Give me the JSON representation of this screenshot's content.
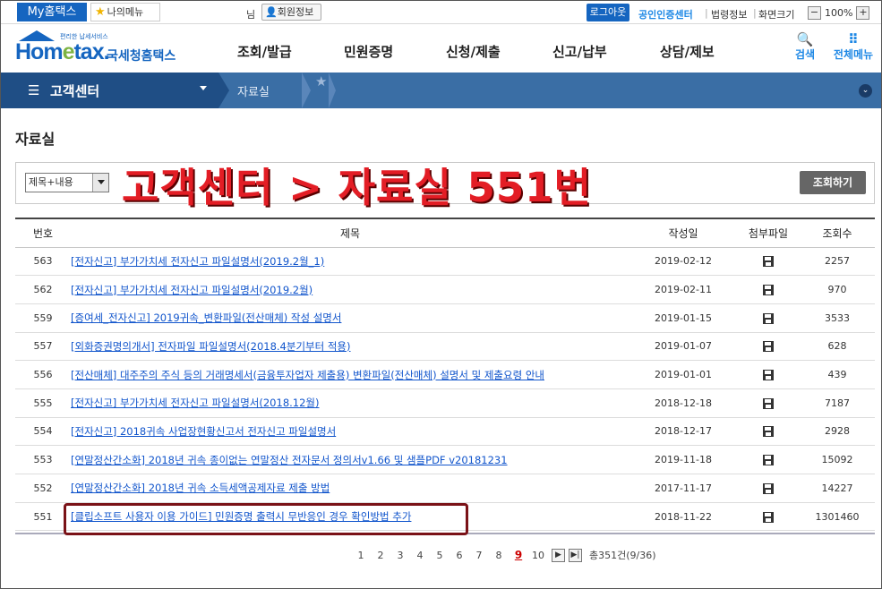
{
  "topbar": {
    "my_hometax": "My홈택스",
    "my_menu": "나의메뉴",
    "user_suffix": "님",
    "member_info": "회원정보",
    "logout": "로그아웃",
    "cert_center": "공인인증센터",
    "law_info": "법령정보",
    "screen_size": "화면크기",
    "zoom_minus": "−",
    "zoom_value": "100%",
    "zoom_plus": "+"
  },
  "header": {
    "logo_small": "편리한 납세서비스",
    "logo_main_a": "Hom",
    "logo_main_e": "e",
    "logo_main_b": "tax.",
    "logo_sub": "국세청홈택스",
    "nav": [
      "조회/발급",
      "민원증명",
      "신청/제출",
      "신고/납부",
      "상담/제보"
    ],
    "search_label": "검색",
    "allmenu_label": "전체메뉴"
  },
  "location": {
    "section": "고객센터",
    "current": "자료실"
  },
  "page": {
    "title": "자료실",
    "select_value": "제목+내용",
    "overlay_caption": "고객센터 > 자료실 551번",
    "search_button": "조회하기"
  },
  "table": {
    "headers": {
      "no": "번호",
      "title": "제목",
      "date": "작성일",
      "file": "첨부파일",
      "views": "조회수"
    },
    "rows": [
      {
        "no": "563",
        "title": "[전자신고] 부가가치세 전자신고 파일설명서(2019.2월_1)",
        "date": "2019-02-12",
        "views": "2257"
      },
      {
        "no": "562",
        "title": "[전자신고] 부가가치세 전자신고 파일설명서(2019.2월)",
        "date": "2019-02-11",
        "views": "970"
      },
      {
        "no": "559",
        "title": "[증여세_전자신고] 2019귀속_변환파일(전산매체) 작성 설명서",
        "date": "2019-01-15",
        "views": "3533"
      },
      {
        "no": "557",
        "title": "[외화증권명의개서] 전자파일 파일설명서(2018.4분기부터 적용)",
        "date": "2019-01-07",
        "views": "628"
      },
      {
        "no": "556",
        "title": "[전산매체] 대주주의 주식 등의 거래명세서(금융투자업자 제출용) 변환파일(전산매체) 설명서 및 제출요령 안내",
        "date": "2019-01-01",
        "views": "439"
      },
      {
        "no": "555",
        "title": "[전자신고] 부가가치세 전자신고 파일설명서(2018.12월)",
        "date": "2018-12-18",
        "views": "7187"
      },
      {
        "no": "554",
        "title": "[전자신고] 2018귀속 사업장현황신고서 전자신고 파일설명서",
        "date": "2018-12-17",
        "views": "2928"
      },
      {
        "no": "553",
        "title": "[연말정산간소화] 2018년 귀속 종이없는 연말정산 전자문서 정의서v1.66 및 샘플PDF v20181231",
        "date": "2019-11-18",
        "views": "15092"
      },
      {
        "no": "552",
        "title": "[연말정산간소화] 2018년 귀속 소득세액공제자료 제출 방법",
        "date": "2017-11-17",
        "views": "14227"
      },
      {
        "no": "551",
        "title": "[클립소프트 사용자 이용 가이드] 민원증명 출력시 무반응인 경우 확인방법 추가",
        "date": "2018-11-22",
        "views": "1301460"
      }
    ]
  },
  "pagination": {
    "pages": [
      "1",
      "2",
      "3",
      "4",
      "5",
      "6",
      "7",
      "8",
      "9",
      "10"
    ],
    "current_page": "9",
    "next": "▶",
    "last": "▶",
    "total": "총351건(9/36)"
  }
}
